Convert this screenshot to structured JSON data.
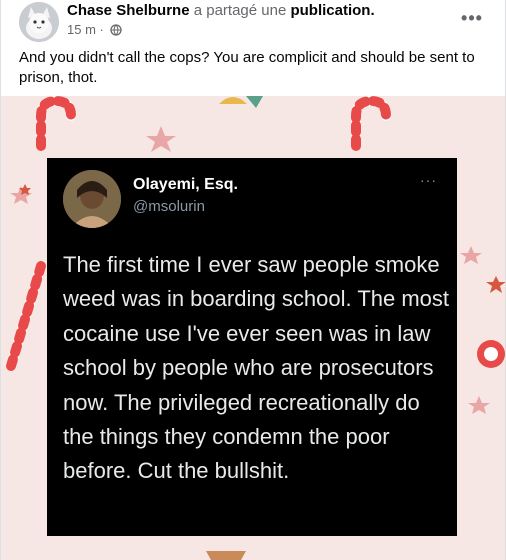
{
  "post": {
    "author": "Chase Shelburne",
    "action": "a partagé une",
    "publication_label": "publication.",
    "timestamp": "15 m ·",
    "privacy_icon": "globe-icon",
    "more_label": "•••",
    "caption": "And you didn't call the cops? You are complicit and should be sent to prison, thot."
  },
  "tweet": {
    "display_name": "Olayemi, Esq.",
    "handle": "@msolurin",
    "more_label": "···",
    "text": "The first time I ever saw people smoke weed was in boarding school. The most cocaine use I've ever seen was in law school by people who are prosecutors now. The privileged recreationally do the things they condemn the poor before. Cut the bullshit."
  },
  "colors": {
    "background_pink": "#f6e7e4",
    "candy_red": "#e84a4a",
    "tweet_bg": "#000000",
    "secondary_text": "#65676b"
  }
}
